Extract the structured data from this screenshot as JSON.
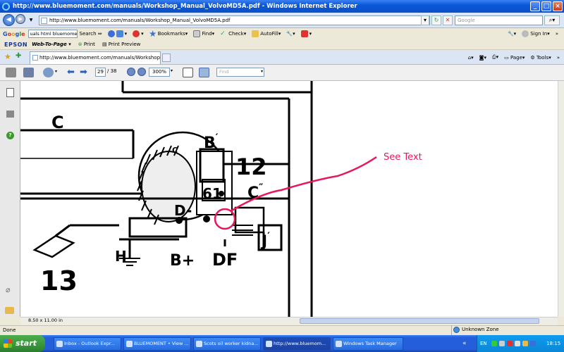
{
  "window": {
    "title": "http://www.bluemoment.com/manuals/Workshop_Manual_VolvoMD5A.pdf - Windows Internet Explorer",
    "min": "_",
    "max": "□",
    "close": "×"
  },
  "address": {
    "url": "http://www.bluemoment.com/manuals/Workshop_Manual_VolvoMD5A.pdf",
    "search_placeholder": "Google"
  },
  "google_toolbar": {
    "search_value": "uals html bluemoment",
    "search_label": "Search",
    "bookmarks": "Bookmarks",
    "find": "Find",
    "check": "Check",
    "autofill": "AutoFill",
    "sign_in": "Sign In"
  },
  "epson_toolbar": {
    "logo": "EPSON",
    "web_to_page": "Web-To-Page",
    "print": "Print",
    "print_preview": "Print Preview"
  },
  "tab": {
    "title": "http://www.bluemoment.com/manuals/Workshop_Ma..."
  },
  "commands": {
    "page": "Page",
    "tools": "Tools"
  },
  "pdf_toolbar": {
    "page_current": "29",
    "page_total": "/ 38",
    "zoom": "300%",
    "find_placeholder": "Find"
  },
  "diagram": {
    "labels": {
      "c": "C",
      "b_prime": "B",
      "twelve": "12",
      "sixty_one": "61",
      "c_dblprime": "C",
      "d_minus": "D-",
      "j_prime": "J",
      "h": "H",
      "b_plus": "B+",
      "df": "DF",
      "thirteen": "13",
      "small_c": "C"
    },
    "annotation": "See Text",
    "annotation_color": "#e8175d"
  },
  "page_size": "8.50 x 11.00 in",
  "status": {
    "left": "Done",
    "zone": "Unknown Zone"
  },
  "taskbar": {
    "start": "start",
    "tasks": [
      "Inbox - Outlook Expr...",
      "BLUEMOMENT • View ...",
      "Scots oil worker kidna...",
      "http://www.bluemom...",
      "Windows Task Manager"
    ],
    "lang": "EN",
    "clock": "18:15"
  }
}
